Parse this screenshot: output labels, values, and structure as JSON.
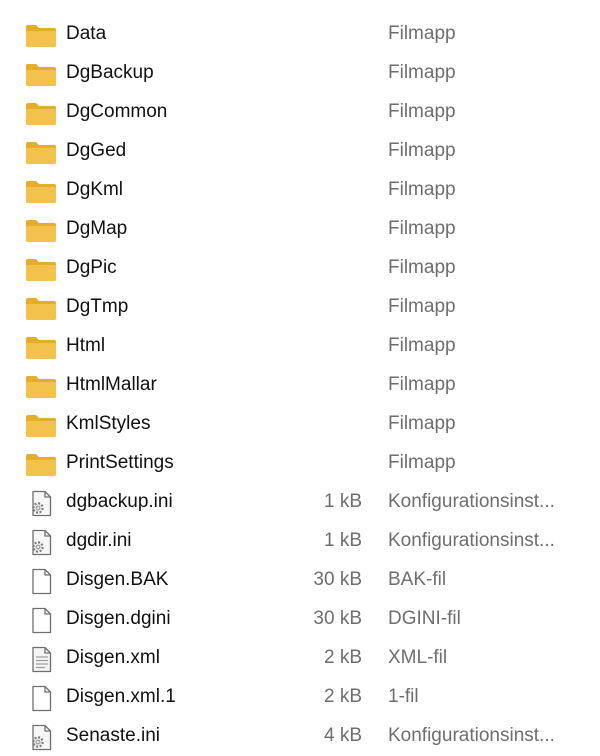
{
  "colors": {
    "folder_body": "#f2c24d",
    "folder_tab": "#e5ad2e",
    "file_outline": "#6f6f6f",
    "secondary_text": "#6e6e6e"
  },
  "items": [
    {
      "name": "Data",
      "size": "",
      "type": "Filmapp",
      "icon": "folder-icon"
    },
    {
      "name": "DgBackup",
      "size": "",
      "type": "Filmapp",
      "icon": "folder-icon"
    },
    {
      "name": "DgCommon",
      "size": "",
      "type": "Filmapp",
      "icon": "folder-icon"
    },
    {
      "name": "DgGed",
      "size": "",
      "type": "Filmapp",
      "icon": "folder-icon"
    },
    {
      "name": "DgKml",
      "size": "",
      "type": "Filmapp",
      "icon": "folder-icon"
    },
    {
      "name": "DgMap",
      "size": "",
      "type": "Filmapp",
      "icon": "folder-icon"
    },
    {
      "name": "DgPic",
      "size": "",
      "type": "Filmapp",
      "icon": "folder-icon"
    },
    {
      "name": "DgTmp",
      "size": "",
      "type": "Filmapp",
      "icon": "folder-icon"
    },
    {
      "name": "Html",
      "size": "",
      "type": "Filmapp",
      "icon": "folder-icon"
    },
    {
      "name": "HtmlMallar",
      "size": "",
      "type": "Filmapp",
      "icon": "folder-icon"
    },
    {
      "name": "KmlStyles",
      "size": "",
      "type": "Filmapp",
      "icon": "folder-icon"
    },
    {
      "name": "PrintSettings",
      "size": "",
      "type": "Filmapp",
      "icon": "folder-icon"
    },
    {
      "name": "dgbackup.ini",
      "size": "1 kB",
      "type": "Konfigurationsinst...",
      "icon": "settings-file-icon"
    },
    {
      "name": "dgdir.ini",
      "size": "1 kB",
      "type": "Konfigurationsinst...",
      "icon": "settings-file-icon"
    },
    {
      "name": "Disgen.BAK",
      "size": "30 kB",
      "type": "BAK-fil",
      "icon": "blank-file-icon"
    },
    {
      "name": "Disgen.dgini",
      "size": "30 kB",
      "type": "DGINI-fil",
      "icon": "blank-file-icon"
    },
    {
      "name": "Disgen.xml",
      "size": "2 kB",
      "type": "XML-fil",
      "icon": "text-file-icon"
    },
    {
      "name": "Disgen.xml.1",
      "size": "2 kB",
      "type": "1-fil",
      "icon": "blank-file-icon"
    },
    {
      "name": "Senaste.ini",
      "size": "4 kB",
      "type": "Konfigurationsinst...",
      "icon": "settings-file-icon"
    }
  ]
}
